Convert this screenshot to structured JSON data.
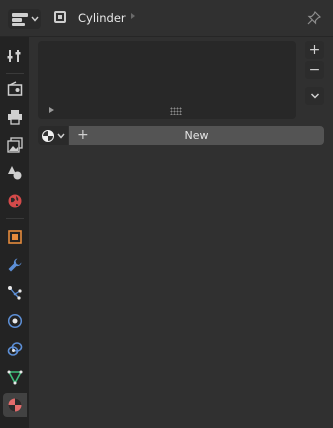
{
  "header": {
    "editor_type_icon": "properties-editor-icon",
    "context_icon": "object-data-icon",
    "title": "Cylinder",
    "pin_icon": "pin-icon"
  },
  "tabs": [
    {
      "name": "tool",
      "icon": "tool-icon"
    },
    {
      "name": "render",
      "icon": "render-icon"
    },
    {
      "name": "output",
      "icon": "output-icon"
    },
    {
      "name": "view-layer",
      "icon": "view-layer-icon"
    },
    {
      "name": "scene",
      "icon": "scene-icon"
    },
    {
      "name": "world",
      "icon": "world-icon"
    },
    {
      "name": "object",
      "icon": "object-icon"
    },
    {
      "name": "modifiers",
      "icon": "wrench-icon"
    },
    {
      "name": "particles",
      "icon": "particles-icon"
    },
    {
      "name": "physics",
      "icon": "physics-icon"
    },
    {
      "name": "constraints",
      "icon": "constraints-icon"
    },
    {
      "name": "data",
      "icon": "mesh-data-icon"
    },
    {
      "name": "material",
      "icon": "material-icon",
      "active": true
    }
  ],
  "material_slots": {
    "add_label": "+",
    "remove_label": "−",
    "menu_icon": "chevron-down-icon"
  },
  "new_row": {
    "browse_icon": "material-sphere-icon",
    "plus_label": "+",
    "new_label": "New"
  }
}
